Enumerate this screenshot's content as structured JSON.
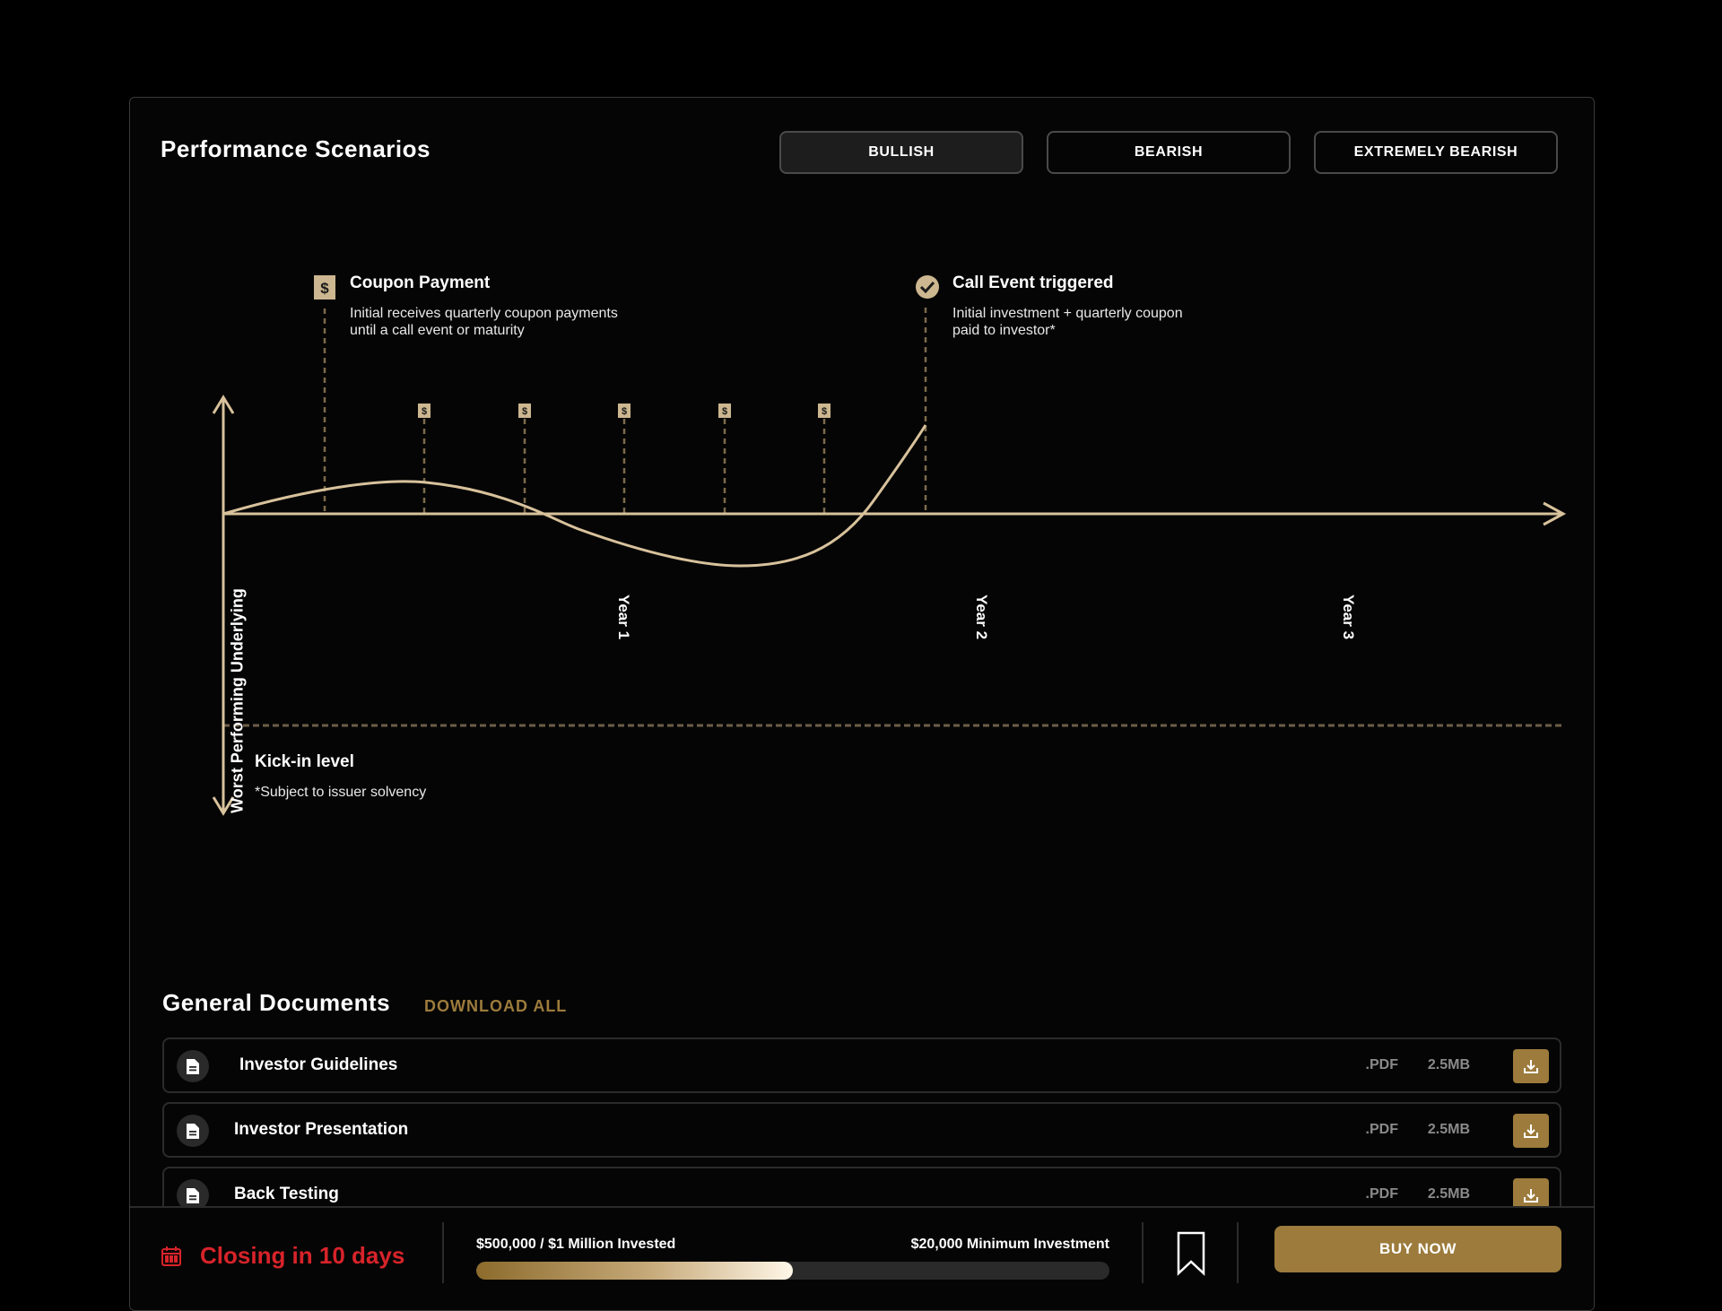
{
  "header": {
    "title": "Performance Scenarios"
  },
  "scenarios": {
    "items": [
      {
        "label": "BULLISH",
        "active": true
      },
      {
        "label": "BEARISH",
        "active": false
      },
      {
        "label": "EXTREMELY BEARISH",
        "active": false
      }
    ]
  },
  "chart": {
    "y_axis_label": "Worst Performing Underlying",
    "x_ticks": [
      "Year 1",
      "Year 2",
      "Year 3"
    ],
    "coupon": {
      "title": "Coupon Payment",
      "description_line1": "Initial receives quarterly coupon payments",
      "description_line2": "until a call event or maturity"
    },
    "call_event": {
      "title": "Call Event triggered",
      "description_line1": "Initial investment + quarterly coupon",
      "description_line2": "paid to investor*"
    },
    "kick_in": {
      "title": "Kick-in level",
      "note": "*Subject to issuer solvency"
    },
    "colors": {
      "line": "#d8c29c",
      "marker": "#cdb790",
      "dashed": "#7c6a4b"
    }
  },
  "documents": {
    "title": "General Documents",
    "download_all": "DOWNLOAD ALL",
    "items": [
      {
        "name": "Investor Guidelines",
        "ext": ".PDF",
        "size": "2.5MB"
      },
      {
        "name": "Investor Presentation",
        "ext": ".PDF",
        "size": "2.5MB"
      },
      {
        "name": "Back Testing",
        "ext": ".PDF",
        "size": "2.5MB"
      }
    ]
  },
  "footer": {
    "closing": "Closing in 10 days",
    "invested": "$500,000 / $1 Million Invested",
    "minimum": "$20,000 Minimum Investment",
    "progress": 0.5,
    "buy_label": "BUY NOW",
    "colors": {
      "closing": "#d8232a",
      "accent": "#9c7b3c"
    }
  }
}
